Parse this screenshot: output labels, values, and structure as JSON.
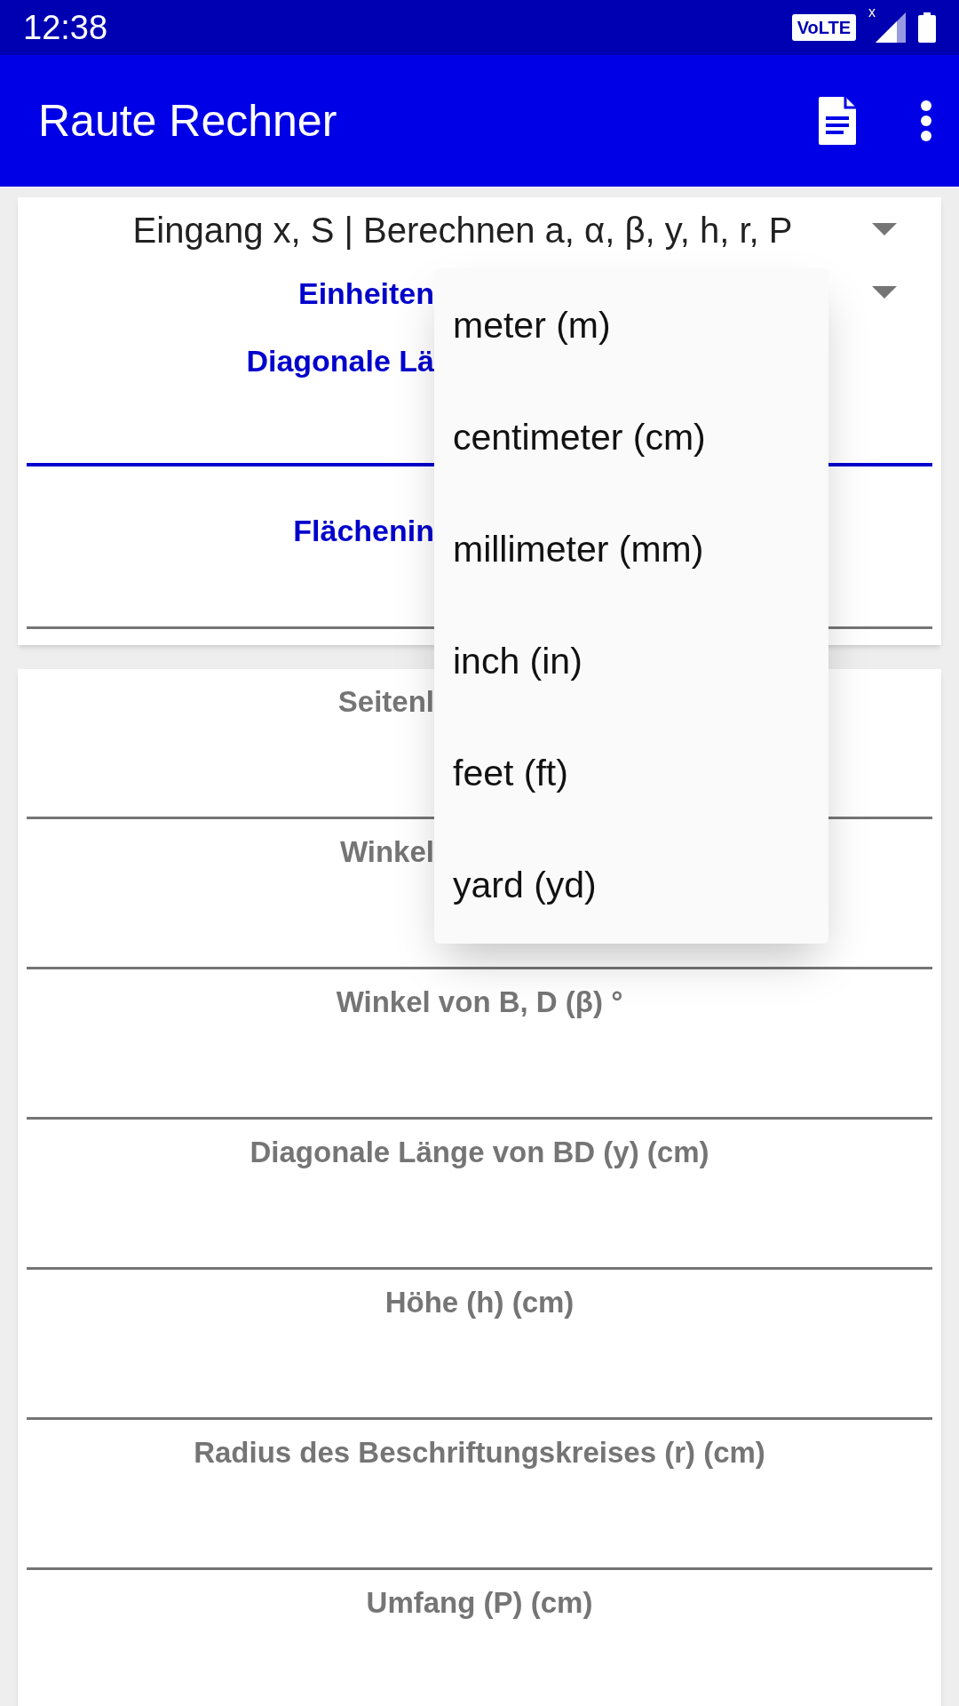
{
  "status_bar": {
    "time": "12:38",
    "volte": "VoLTE",
    "signal_mark": "x"
  },
  "app_bar": {
    "title": "Raute Rechner"
  },
  "mode_dropdown": {
    "value": "Eingang x, S | Berechnen a, α, β, y, h, r, P"
  },
  "units_dropdown": {
    "label": "Einheiten"
  },
  "input_fields": [
    {
      "label": "Diagonale Lä",
      "focused": true
    },
    {
      "label": "Flächenin",
      "focused": false
    }
  ],
  "result_fields": [
    {
      "label": "Seitenl"
    },
    {
      "label": "Winkel"
    },
    {
      "label": "Winkel von B, D (β) °"
    },
    {
      "label": "Diagonale Länge von BD (y) (cm)"
    },
    {
      "label": "Höhe (h) (cm)"
    },
    {
      "label": "Radius des Beschriftungskreises (r) (cm)"
    },
    {
      "label": "Umfang (P) (cm)"
    }
  ],
  "units_menu": {
    "options": [
      "meter (m)",
      "centimeter (cm)",
      "millimeter (mm)",
      "inch (in)",
      "feet (ft)",
      "yard (yd)"
    ]
  }
}
